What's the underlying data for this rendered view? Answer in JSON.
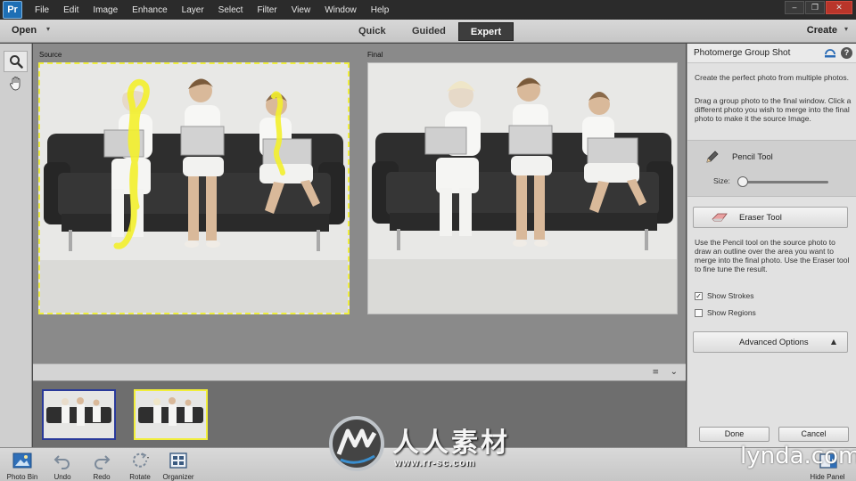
{
  "menubar": {
    "app_icon": "Pr",
    "items": [
      "File",
      "Edit",
      "Image",
      "Enhance",
      "Layer",
      "Select",
      "Filter",
      "View",
      "Window",
      "Help"
    ],
    "window_buttons": [
      "‒",
      "❐",
      "✕"
    ]
  },
  "modebar": {
    "open_label": "Open",
    "tabs": [
      "Quick",
      "Guided",
      "Expert"
    ],
    "active_tab": "Expert",
    "create_label": "Create"
  },
  "canvas": {
    "source_label": "Source",
    "final_label": "Final",
    "stroke_color": "#f3f02c"
  },
  "bin": {
    "sort_icon": "≡",
    "collapse_icon": "⌄"
  },
  "panel": {
    "title": "Photomerge Group Shot",
    "help": "?",
    "intro": "Create the perfect photo from multiple photos.",
    "instructions": "Drag a group photo to the final window. Click a different photo you wish to merge into the final photo to make it the source Image.",
    "pencil_label": "Pencil Tool",
    "size_label": "Size:",
    "eraser_label": "Eraser Tool",
    "help_text": "Use the Pencil tool on the source photo to draw an outline over the area you want to merge into the final photo. Use the Eraser tool to fine tune the result.",
    "show_strokes": "Show Strokes",
    "show_strokes_checked": "✓",
    "show_regions": "Show Regions",
    "advanced_label": "Advanced Options",
    "advanced_caret": "▲",
    "done_label": "Done",
    "cancel_label": "Cancel"
  },
  "taskbar": {
    "photo_bin": "Photo Bin",
    "undo": "Undo",
    "redo": "Redo",
    "rotate": "Rotate",
    "organizer": "Organizer",
    "hide_panel": "Hide Panel"
  },
  "watermark": {
    "chinese": "人人素材",
    "url": "www.rr-sc.com",
    "lynda": "lynda.com"
  }
}
